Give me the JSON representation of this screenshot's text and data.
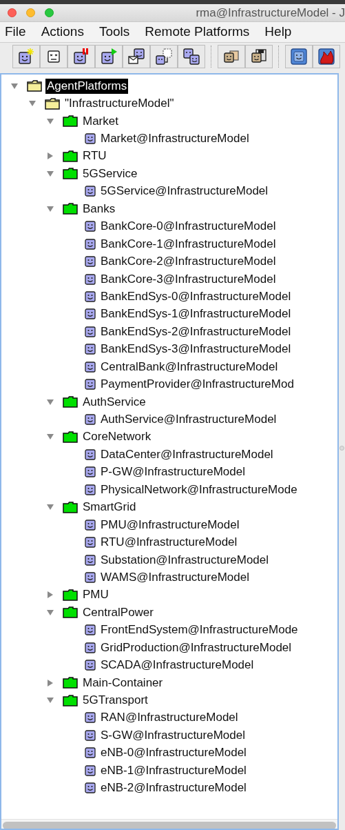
{
  "window": {
    "title": "rma@InfrastructureModel - J"
  },
  "menu": [
    "File",
    "Actions",
    "Tools",
    "Remote Platforms",
    "Help"
  ],
  "toolbar": [
    [
      {
        "kind": "new-agent"
      },
      {
        "kind": "kill-agent"
      },
      {
        "kind": "suspend-agent"
      },
      {
        "kind": "resume-agent"
      },
      {
        "kind": "send-message"
      },
      {
        "kind": "migrate-agent"
      },
      {
        "kind": "clone-agent"
      }
    ],
    [
      {
        "kind": "load-agent"
      },
      {
        "kind": "save-agent"
      }
    ],
    [
      {
        "kind": "gui-agent"
      },
      {
        "kind": "shutdown"
      }
    ]
  ],
  "tree": [
    {
      "label": "AgentPlatforms",
      "kind": "folder",
      "expanded": true,
      "selected": true,
      "children": [
        {
          "label": "\"InfrastructureModel\"",
          "kind": "folder",
          "expanded": true,
          "selected": false,
          "children": [
            {
              "label": "Market",
              "kind": "container",
              "expanded": true,
              "selected": false,
              "children": [
                {
                  "label": "Market@InfrastructureModel",
                  "kind": "agent",
                  "selected": false
                }
              ]
            },
            {
              "label": "RTU",
              "kind": "container",
              "expanded": false,
              "selected": false
            },
            {
              "label": "5GService",
              "kind": "container",
              "expanded": true,
              "selected": false,
              "children": [
                {
                  "label": "5GService@InfrastructureModel",
                  "kind": "agent",
                  "selected": false
                }
              ]
            },
            {
              "label": "Banks",
              "kind": "container",
              "expanded": true,
              "selected": false,
              "children": [
                {
                  "label": "BankCore-0@InfrastructureModel",
                  "kind": "agent",
                  "selected": false
                },
                {
                  "label": "BankCore-1@InfrastructureModel",
                  "kind": "agent",
                  "selected": false
                },
                {
                  "label": "BankCore-2@InfrastructureModel",
                  "kind": "agent",
                  "selected": false
                },
                {
                  "label": "BankCore-3@InfrastructureModel",
                  "kind": "agent",
                  "selected": false
                },
                {
                  "label": "BankEndSys-0@InfrastructureModel",
                  "kind": "agent",
                  "selected": false
                },
                {
                  "label": "BankEndSys-1@InfrastructureModel",
                  "kind": "agent",
                  "selected": false
                },
                {
                  "label": "BankEndSys-2@InfrastructureModel",
                  "kind": "agent",
                  "selected": false
                },
                {
                  "label": "BankEndSys-3@InfrastructureModel",
                  "kind": "agent",
                  "selected": false
                },
                {
                  "label": "CentralBank@InfrastructureModel",
                  "kind": "agent",
                  "selected": false
                },
                {
                  "label": "PaymentProvider@InfrastructureMod",
                  "kind": "agent",
                  "selected": false
                }
              ]
            },
            {
              "label": "AuthService",
              "kind": "container",
              "expanded": true,
              "selected": false,
              "children": [
                {
                  "label": "AuthService@InfrastructureModel",
                  "kind": "agent",
                  "selected": false
                }
              ]
            },
            {
              "label": "CoreNetwork",
              "kind": "container",
              "expanded": true,
              "selected": false,
              "children": [
                {
                  "label": "DataCenter@InfrastructureModel",
                  "kind": "agent",
                  "selected": false
                },
                {
                  "label": "P-GW@InfrastructureModel",
                  "kind": "agent",
                  "selected": false
                },
                {
                  "label": "PhysicalNetwork@InfrastructureMode",
                  "kind": "agent",
                  "selected": false
                }
              ]
            },
            {
              "label": "SmartGrid",
              "kind": "container",
              "expanded": true,
              "selected": false,
              "children": [
                {
                  "label": "PMU@InfrastructureModel",
                  "kind": "agent",
                  "selected": false
                },
                {
                  "label": "RTU@InfrastructureModel",
                  "kind": "agent",
                  "selected": false
                },
                {
                  "label": "Substation@InfrastructureModel",
                  "kind": "agent",
                  "selected": false
                },
                {
                  "label": "WAMS@InfrastructureModel",
                  "kind": "agent",
                  "selected": false
                }
              ]
            },
            {
              "label": "PMU",
              "kind": "container",
              "expanded": false,
              "selected": false
            },
            {
              "label": "CentralPower",
              "kind": "container",
              "expanded": true,
              "selected": false,
              "children": [
                {
                  "label": "FrontEndSystem@InfrastructureMode",
                  "kind": "agent",
                  "selected": false
                },
                {
                  "label": "GridProduction@InfrastructureModel",
                  "kind": "agent",
                  "selected": false
                },
                {
                  "label": "SCADA@InfrastructureModel",
                  "kind": "agent",
                  "selected": false
                }
              ]
            },
            {
              "label": "Main-Container",
              "kind": "container",
              "expanded": false,
              "selected": false
            },
            {
              "label": "5GTransport",
              "kind": "container",
              "expanded": true,
              "selected": false,
              "children": [
                {
                  "label": "RAN@InfrastructureModel",
                  "kind": "agent",
                  "selected": false
                },
                {
                  "label": "S-GW@InfrastructureModel",
                  "kind": "agent",
                  "selected": false
                },
                {
                  "label": "eNB-0@InfrastructureModel",
                  "kind": "agent",
                  "selected": false
                },
                {
                  "label": "eNB-1@InfrastructureModel",
                  "kind": "agent",
                  "selected": false
                },
                {
                  "label": "eNB-2@InfrastructureModel",
                  "kind": "agent",
                  "selected": false
                }
              ]
            }
          ]
        }
      ]
    }
  ]
}
